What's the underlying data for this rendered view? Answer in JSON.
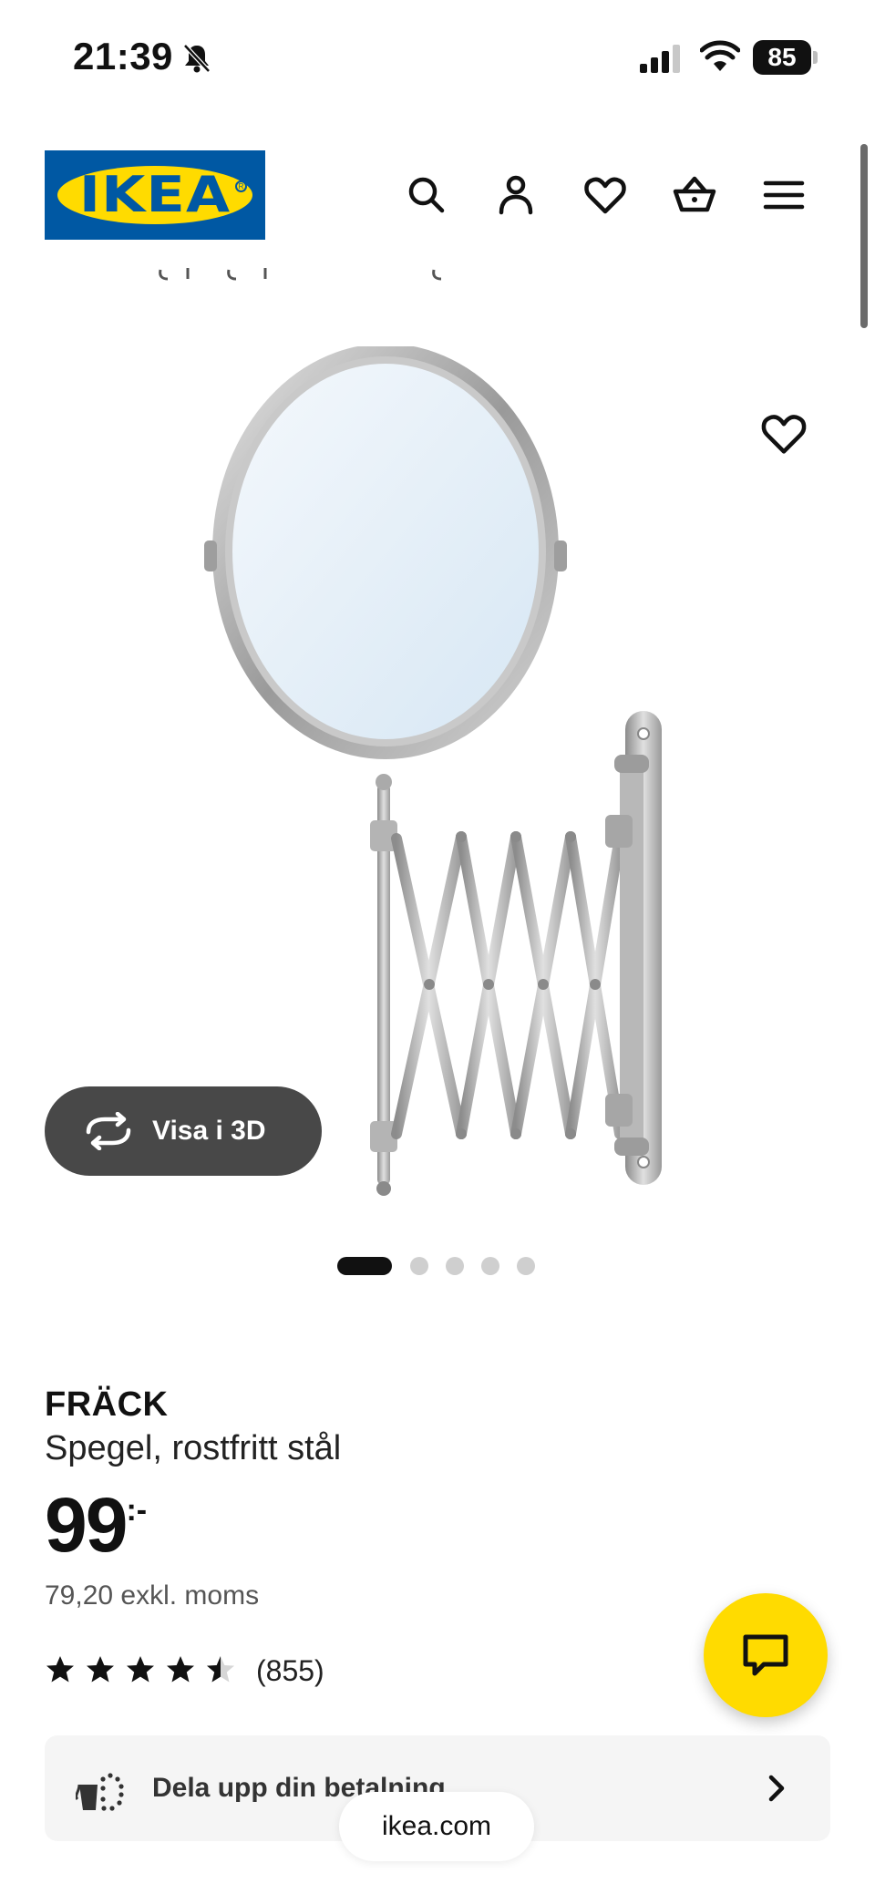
{
  "status_bar": {
    "time": "21:39",
    "battery": "85"
  },
  "header": {
    "logo_text": "IKEA"
  },
  "product": {
    "name": "FRÄCK",
    "description": "Spegel, rostfritt stål",
    "price": "99",
    "price_suffix": ":-",
    "price_excl": "79,20 exkl. moms",
    "rating_value": 4.5,
    "rating_count": "(855)",
    "view_3d_label": "Visa i 3D",
    "image_count": 5,
    "active_image": 1
  },
  "payment_banner": {
    "label": "Dela upp din betalning"
  },
  "browser": {
    "url": "ikea.com"
  },
  "colors": {
    "brand_blue": "#0058a3",
    "brand_yellow": "#ffdb00"
  }
}
